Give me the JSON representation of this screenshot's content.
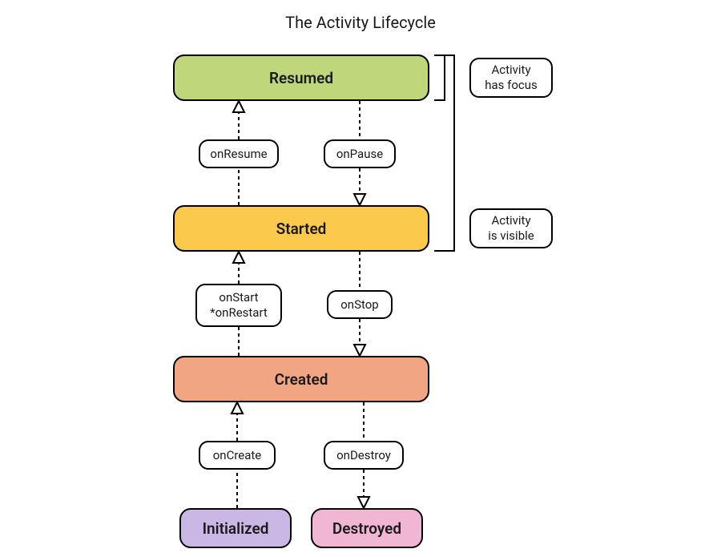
{
  "title": "The Activity Lifecycle",
  "states": {
    "resumed": "Resumed",
    "started": "Started",
    "created": "Created",
    "initialized": "Initialized",
    "destroyed": "Destroyed"
  },
  "transitions": {
    "onResume": "onResume",
    "onPause": "onPause",
    "onStartRestart": "onStart\n*onRestart",
    "onStop": "onStop",
    "onCreate": "onCreate",
    "onDestroy": "onDestroy"
  },
  "annotations": {
    "hasFocus": "Activity\nhas focus",
    "isVisible": "Activity\nis visible"
  },
  "colors": {
    "resumed": "#bfd77a",
    "started": "#fbc94b",
    "created": "#f2a582",
    "initialized": "#cbb7e5",
    "destroyed": "#f1b6d4"
  }
}
